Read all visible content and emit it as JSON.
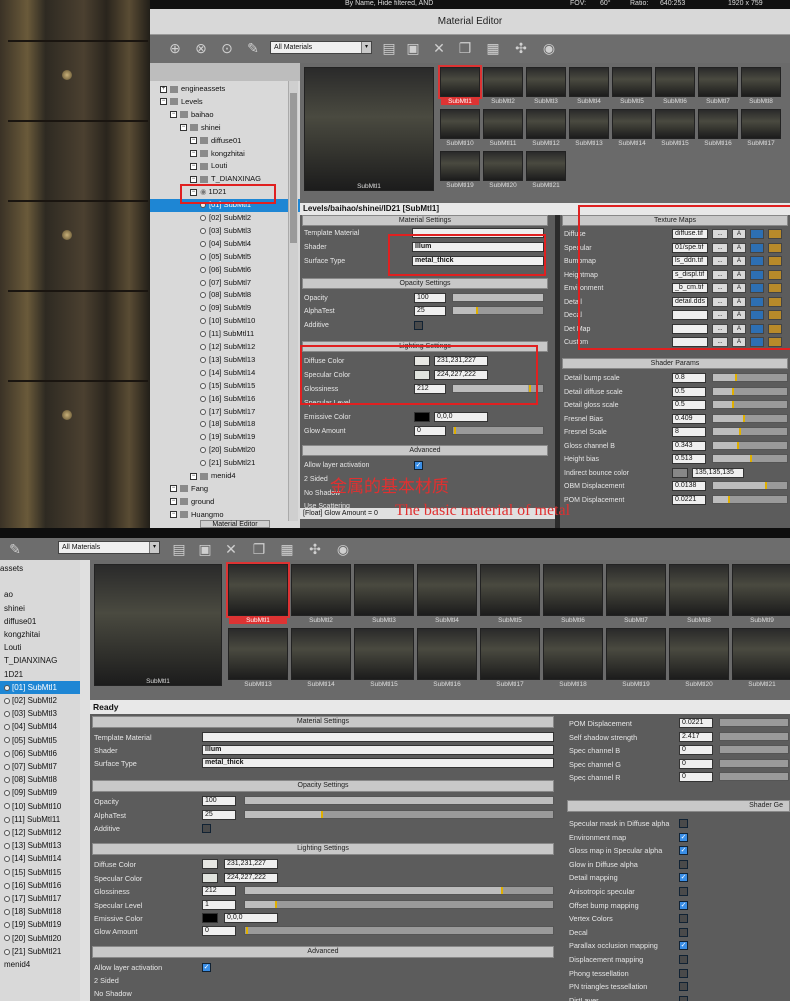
{
  "top": {
    "topbar": {
      "sort": "By Name, Hide filtered, AND",
      "fov": "FOV:",
      "fov_val": "60°",
      "ratio": "Ratio:",
      "ratio_val": "640:253",
      "res": "1920 x 759"
    },
    "window_title": "Material Editor",
    "filter_combo": "All Materials",
    "tree": [
      {
        "label": "engineassets",
        "indent": 0,
        "type": "expander"
      },
      {
        "label": "Levels",
        "indent": 0,
        "type": "folder"
      },
      {
        "label": "baihao",
        "indent": 1,
        "type": "folder"
      },
      {
        "label": "shinei",
        "indent": 2,
        "type": "folder"
      },
      {
        "label": "diffuse01",
        "indent": 3,
        "type": "folder"
      },
      {
        "label": "kongzhitai",
        "indent": 3,
        "type": "folder"
      },
      {
        "label": "Louti",
        "indent": 3,
        "type": "folder"
      },
      {
        "label": "T_DIANXINAG",
        "indent": 3,
        "type": "folder"
      },
      {
        "label": "1D21",
        "indent": 3,
        "type": "material"
      },
      {
        "label": "[01] SubMtl1",
        "indent": 4,
        "type": "sub",
        "selected": true
      },
      {
        "label": "[02] SubMtl2",
        "indent": 4,
        "type": "sub"
      },
      {
        "label": "[03] SubMtl3",
        "indent": 4,
        "type": "sub"
      },
      {
        "label": "[04] SubMtl4",
        "indent": 4,
        "type": "sub"
      },
      {
        "label": "[05] SubMtl5",
        "indent": 4,
        "type": "sub"
      },
      {
        "label": "[06] SubMtl6",
        "indent": 4,
        "type": "sub"
      },
      {
        "label": "[07] SubMtl7",
        "indent": 4,
        "type": "sub"
      },
      {
        "label": "[08] SubMtl8",
        "indent": 4,
        "type": "sub"
      },
      {
        "label": "[09] SubMtl9",
        "indent": 4,
        "type": "sub"
      },
      {
        "label": "[10] SubMtl10",
        "indent": 4,
        "type": "sub"
      },
      {
        "label": "[11] SubMtl11",
        "indent": 4,
        "type": "sub"
      },
      {
        "label": "[12] SubMtl12",
        "indent": 4,
        "type": "sub"
      },
      {
        "label": "[13] SubMtl13",
        "indent": 4,
        "type": "sub"
      },
      {
        "label": "[14] SubMtl14",
        "indent": 4,
        "type": "sub"
      },
      {
        "label": "[15] SubMtl15",
        "indent": 4,
        "type": "sub"
      },
      {
        "label": "[16] SubMtl16",
        "indent": 4,
        "type": "sub"
      },
      {
        "label": "[17] SubMtl17",
        "indent": 4,
        "type": "sub"
      },
      {
        "label": "[18] SubMtl18",
        "indent": 4,
        "type": "sub"
      },
      {
        "label": "[19] SubMtl19",
        "indent": 4,
        "type": "sub"
      },
      {
        "label": "[20] SubMtl20",
        "indent": 4,
        "type": "sub"
      },
      {
        "label": "[21] SubMtl21",
        "indent": 4,
        "type": "sub"
      },
      {
        "label": "menid4",
        "indent": 3,
        "type": "folder"
      },
      {
        "label": "Fang",
        "indent": 1,
        "type": "folder"
      },
      {
        "label": "ground",
        "indent": 1,
        "type": "folder"
      },
      {
        "label": "Huangmo",
        "indent": 1,
        "type": "folder"
      }
    ],
    "thumbs": [
      "SubMtl1",
      "SubMtl2",
      "SubMtl3",
      "SubMtl4",
      "SubMtl5",
      "SubMtl6",
      "SubMtl7",
      "SubMtl8",
      "SubMtl10",
      "SubMtl11",
      "SubMtl12",
      "SubMtl13",
      "SubMtl14",
      "SubMtl15",
      "SubMtl16",
      "SubMtl17",
      "SubMtl19",
      "SubMtl20",
      "SubMtl21"
    ],
    "preview_label": "SubMtl1",
    "path": "Levels/baihao/shinei/ID21 [SubMtl1]",
    "material_settings": {
      "title": "Material Settings",
      "template": "Template Material",
      "shader": "Shader",
      "shader_val": "Illum",
      "surface": "Surface Type",
      "surface_val": "metal_thick"
    },
    "opacity_settings": {
      "title": "Opacity Settings",
      "opacity": "Opacity",
      "opacity_val": "100",
      "alphatest": "AlphaTest",
      "alphatest_val": "25",
      "additive": "Additive"
    },
    "lighting_settings": {
      "title": "Lighting Settings",
      "diffuse": "Diffuse Color",
      "diffuse_val": "231,231,227",
      "specular": "Specular Color",
      "specular_val": "224,227,222",
      "gloss": "Glossiness",
      "gloss_val": "212",
      "speclevel": "Specular Level",
      "emissive": "Emissive Color",
      "emissive_val": "0,0,0",
      "glow": "Glow Amount",
      "glow_val": "0"
    },
    "advanced": {
      "title": "Advanced",
      "layer": "Allow layer activation",
      "twosided": "2 Sided",
      "noshadow": "No Shadow",
      "scatter": "Use Scattering"
    },
    "status": "[Float] Glow Amount = 0",
    "tab": "Material Editor",
    "texture_maps": {
      "title": "Texture Maps",
      "rows": [
        {
          "label": "Diffuse",
          "file": "diffuse.tif"
        },
        {
          "label": "Specular",
          "file": "01/spe.tif"
        },
        {
          "label": "Bumpmap",
          "file": "ls_ddn.tif"
        },
        {
          "label": "Heightmap",
          "file": "s_displ.tif"
        },
        {
          "label": "Environment",
          "file": "_b_cm.tif"
        },
        {
          "label": "Detail",
          "file": "detail.dds"
        },
        {
          "label": "Decal",
          "file": ""
        },
        {
          "label": "Det Map",
          "file": ""
        },
        {
          "label": "Custom",
          "file": ""
        }
      ],
      "btn_dots": "...",
      "btn_a": "A"
    },
    "shader_params": {
      "title": "Shader Params",
      "rows": [
        {
          "label": "Detail bump scale",
          "val": "0.8",
          "pct": 0.3
        },
        {
          "label": "Detail diffuse scale",
          "val": "0.5",
          "pct": 0.25
        },
        {
          "label": "Detail gloss scale",
          "val": "0.5",
          "pct": 0.25
        },
        {
          "label": "Fresnel Bias",
          "val": "0.409",
          "pct": 0.4
        },
        {
          "label": "Fresnel Scale",
          "val": "8",
          "pct": 0.35
        },
        {
          "label": "Gloss channel B",
          "val": "0.343",
          "pct": 0.33
        },
        {
          "label": "Height bias",
          "val": "0.513",
          "pct": 0.5
        },
        {
          "label": "Indirect bounce color",
          "val": "135,135,135",
          "pct": 0
        },
        {
          "label": "OBM Displacement",
          "val": "0.0138",
          "pct": 0.7
        },
        {
          "label": "POM Displacement",
          "val": "0.0221",
          "pct": 0.2
        }
      ]
    },
    "overlay_cn": "金属的基本材质",
    "overlay_en": "The basic material of metal"
  },
  "bot": {
    "filter_combo": "All Materials",
    "tree": [
      {
        "label": "assets"
      },
      {
        "label": ""
      },
      {
        "label": "ao"
      },
      {
        "label": "shinei"
      },
      {
        "label": "diffuse01"
      },
      {
        "label": "kongzhitai"
      },
      {
        "label": "Louti"
      },
      {
        "label": "T_DIANXINAG"
      },
      {
        "label": "1D21"
      },
      {
        "label": "[01] SubMtl1",
        "selected": true
      },
      {
        "label": "[02] SubMtl2"
      },
      {
        "label": "[03] SubMtl3"
      },
      {
        "label": "[04] SubMtl4"
      },
      {
        "label": "[05] SubMtl5"
      },
      {
        "label": "[06] SubMtl6"
      },
      {
        "label": "[07] SubMtl7"
      },
      {
        "label": "[08] SubMtl8"
      },
      {
        "label": "[09] SubMtl9"
      },
      {
        "label": "[10] SubMtl10"
      },
      {
        "label": "[11] SubMtl11"
      },
      {
        "label": "[12] SubMtl12"
      },
      {
        "label": "[13] SubMtl13"
      },
      {
        "label": "[14] SubMtl14"
      },
      {
        "label": "[15] SubMtl15"
      },
      {
        "label": "[16] SubMtl16"
      },
      {
        "label": "[17] SubMtl17"
      },
      {
        "label": "[18] SubMtl18"
      },
      {
        "label": "[19] SubMtl19"
      },
      {
        "label": "[20] SubMtl20"
      },
      {
        "label": "[21] SubMtl21"
      },
      {
        "label": "menid4"
      },
      {
        "label": ""
      }
    ],
    "thumbs_row1": [
      "SubMtl1",
      "SubMtl2",
      "SubMtl3",
      "SubMtl4",
      "SubMtl5",
      "SubMtl6",
      "SubMtl7",
      "SubMtl8",
      "SubMtl9"
    ],
    "thumbs_row2": [
      "SubMtl13",
      "SubMtl14",
      "SubMtl15",
      "SubMtl16",
      "SubMtl17",
      "SubMtl18",
      "SubMtl19",
      "SubMtl20",
      "SubMtl21"
    ],
    "preview_label": "SubMtl1",
    "path": "Ready",
    "material_settings": {
      "title": "Material Settings",
      "template": "Template Material",
      "shader": "Shader",
      "shader_val": "Illum",
      "surface": "Surface Type",
      "surface_val": "metal_thick"
    },
    "opacity_settings": {
      "title": "Opacity Settings",
      "opacity": "Opacity",
      "opacity_val": "100",
      "alphatest": "AlphaTest",
      "alphatest_val": "25",
      "additive": "Additive"
    },
    "lighting_settings": {
      "title": "Lighting Settings",
      "diffuse": "Diffuse Color",
      "diffuse_val": "231,231,227",
      "specular": "Specular Color",
      "specular_val": "224,227,222",
      "gloss": "Glossiness",
      "gloss_val": "212",
      "speclevel": "Specular Level",
      "speclevel_val": "1",
      "emissive": "Emissive Color",
      "emissive_val": "0,0,0",
      "glow": "Glow Amount",
      "glow_val": "0"
    },
    "advanced": {
      "title": "Advanced",
      "layer": "Allow layer activation",
      "twosided": "2 Sided",
      "noshadow": "No Shadow"
    },
    "params": [
      {
        "label": "POM Displacement",
        "val": "0.0221"
      },
      {
        "label": "Self shadow strength",
        "val": "2.417"
      },
      {
        "label": "Spec channel B",
        "val": "0"
      },
      {
        "label": "Spec channel G",
        "val": "0"
      },
      {
        "label": "Spec channel R",
        "val": "0"
      }
    ],
    "shader_gen_title": "Shader Ge",
    "flags": [
      {
        "label": "Specular mask in Diffuse alpha",
        "on": false
      },
      {
        "label": "Environment map",
        "on": true
      },
      {
        "label": "Gloss map in Specular alpha",
        "on": true
      },
      {
        "label": "Glow in Diffuse alpha",
        "on": false
      },
      {
        "label": "Detail mapping",
        "on": true
      },
      {
        "label": "Anisotropic specular",
        "on": false
      },
      {
        "label": "Offset bump mapping",
        "on": true
      },
      {
        "label": "Vertex Colors",
        "on": false
      },
      {
        "label": "Decal",
        "on": false
      },
      {
        "label": "Parallax occlusion mapping",
        "on": true
      },
      {
        "label": "Displacement mapping",
        "on": false
      },
      {
        "label": "Phong tessellation",
        "on": false
      },
      {
        "label": "PN triangles tessellation",
        "on": false
      },
      {
        "label": "DirtLayer",
        "on": false
      }
    ]
  }
}
